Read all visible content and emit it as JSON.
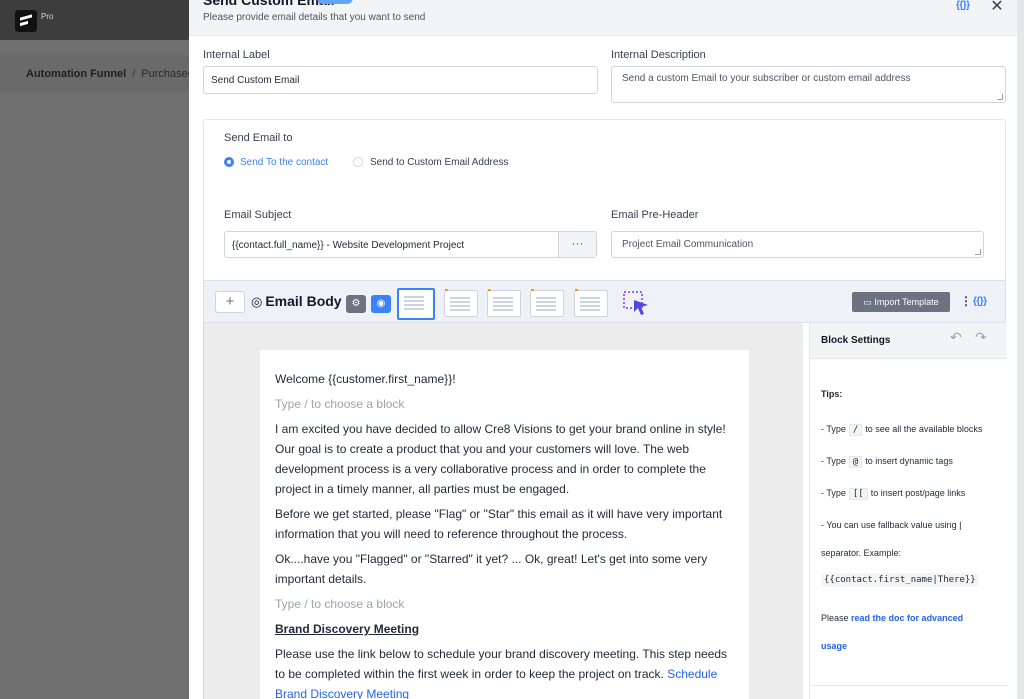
{
  "background": {
    "brand_pro": "Pro",
    "breadcrumb": {
      "root": "Automation Funnel",
      "separator": "/",
      "current": "Purchased V"
    }
  },
  "modal": {
    "title": "Send Custom Email",
    "subtitle": "Please provide email details that you want to send",
    "smartcode_icon": "{{}}",
    "close_label": "✕"
  },
  "form": {
    "internal_label": {
      "label": "Internal Label",
      "value": "Send Custom Email"
    },
    "internal_description": {
      "label": "Internal Description",
      "value": "Send a custom Email to your subscriber or custom email address"
    },
    "send_email_to": {
      "label": "Send Email to",
      "options": [
        {
          "label": "Send To the contact",
          "selected": true
        },
        {
          "label": "Send to Custom Email Address",
          "selected": false
        }
      ]
    },
    "email_subject": {
      "label": "Email Subject",
      "value": "{{contact.full_name}} - Website Development Project",
      "more": "···"
    },
    "email_preheader": {
      "label": "Email Pre-Header",
      "value": "Project Email Communication"
    }
  },
  "toolbar": {
    "add": "+",
    "title_icon": "◎",
    "title": "Email Body",
    "import_template": "Import Template",
    "import_icon": "folder-icon",
    "more": "⋮",
    "smartcode": "{{}}",
    "accent_color": "#3b82f6"
  },
  "editor": {
    "paragraphs": [
      {
        "text": "Welcome {{customer.first_name}}!"
      },
      {
        "text": "Type / to choose a block"
      },
      {
        "text": "I am excited you have decided to allow Cre8 Visions to get your brand online in style! Our goal is to create a product that you and your customers will love. The web development process is a very collaborative process and in order to complete the project in a timely manner, all parties must be engaged."
      },
      {
        "text": "Before we get started, please \"Flag\" or \"Star\" this email as it will have very important information that you will need to reference throughout the process."
      },
      {
        "text": "Ok....have you \"Flagged\" or \"Starred\" it yet? ... Ok, great! Let's get into some very important details."
      },
      {
        "text": "Type / to choose a block"
      },
      {
        "text": "Brand Discovery Meeting"
      },
      {
        "text": "Please use the link below to schedule your brand discovery meeting. This step needs to be completed within the first week in order to keep the project on track."
      }
    ],
    "link_text": "Schedule Brand Discovery Meeting"
  },
  "block_settings": {
    "title": "Block Settings",
    "undo": "↶",
    "redo": "↷",
    "tips_label": "Tips:",
    "tip1_pre": "- Type",
    "tip1_key": "/",
    "tip1_post": "to see all the available blocks",
    "tip2_pre": "- Type",
    "tip2_key": "@",
    "tip2_post": "to insert dynamic tags",
    "tip3_pre": "- Type",
    "tip3_key": "[[",
    "tip3_post": "to insert post/page links",
    "tip4": "- You can use fallback value using |",
    "tip4b": "separator. Example:",
    "example": "{{contact.first_name|There}}",
    "please": "Please",
    "doc_link_1": "read the doc for advanced",
    "doc_link_2": "usage"
  }
}
